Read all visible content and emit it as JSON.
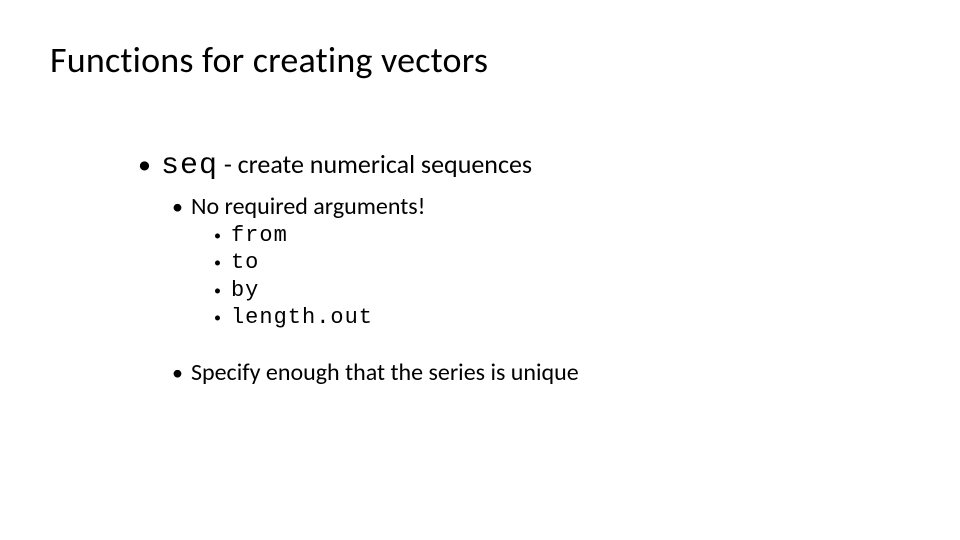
{
  "title": "Functions for creating vectors",
  "l1": {
    "code": "seq",
    "rest": " - create numerical sequences"
  },
  "l2a": "No required arguments!",
  "args": {
    "a0": "from",
    "a1": "to",
    "a2": "by",
    "a3": "length.out"
  },
  "l2b": "Specify enough that the series is unique"
}
